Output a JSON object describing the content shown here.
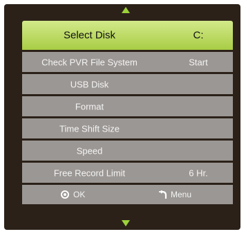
{
  "nav": {
    "up_icon": "arrow-up-icon",
    "down_icon": "arrow-down-icon",
    "accent": "#9dd13a"
  },
  "menu": {
    "selected_color": "#a8cd45",
    "items": [
      {
        "label": "Select Disk",
        "value": "C:"
      },
      {
        "label": "Check PVR File System",
        "value": "Start"
      },
      {
        "label": "USB Disk",
        "value": ""
      },
      {
        "label": "Format",
        "value": ""
      },
      {
        "label": "Time Shift Size",
        "value": ""
      },
      {
        "label": "Speed",
        "value": ""
      },
      {
        "label": "Free Record Limit",
        "value": "6 Hr."
      }
    ]
  },
  "footer": {
    "ok_label": "OK",
    "ok_icon": "ok-circle-icon",
    "menu_label": "Menu",
    "menu_icon": "back-arrow-icon"
  }
}
